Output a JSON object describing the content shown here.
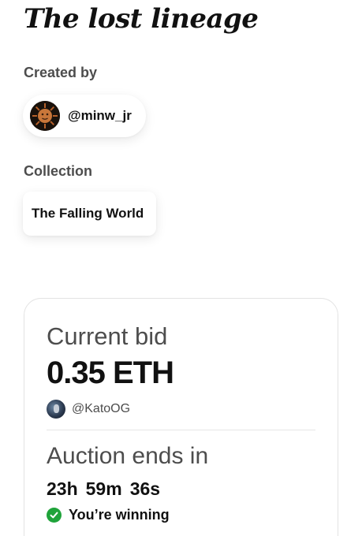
{
  "artwork": {
    "title": "The lost lineage"
  },
  "creator": {
    "label": "Created by",
    "handle": "@minw_jr",
    "avatar_icon": "sun-face-avatar"
  },
  "collection": {
    "label": "Collection",
    "name": "The Falling World"
  },
  "auction": {
    "current_bid_label": "Current bid",
    "current_bid_amount": "0.35 ETH",
    "bidder_handle": "@KatoOG",
    "bidder_avatar_icon": "bidder-avatar",
    "ends_label": "Auction ends in",
    "countdown": {
      "hours": "23h",
      "minutes": "59m",
      "seconds": "36s"
    },
    "status_text": "You’re winning",
    "status_icon": "check-circle-icon",
    "status_color": "#1fa33a"
  }
}
